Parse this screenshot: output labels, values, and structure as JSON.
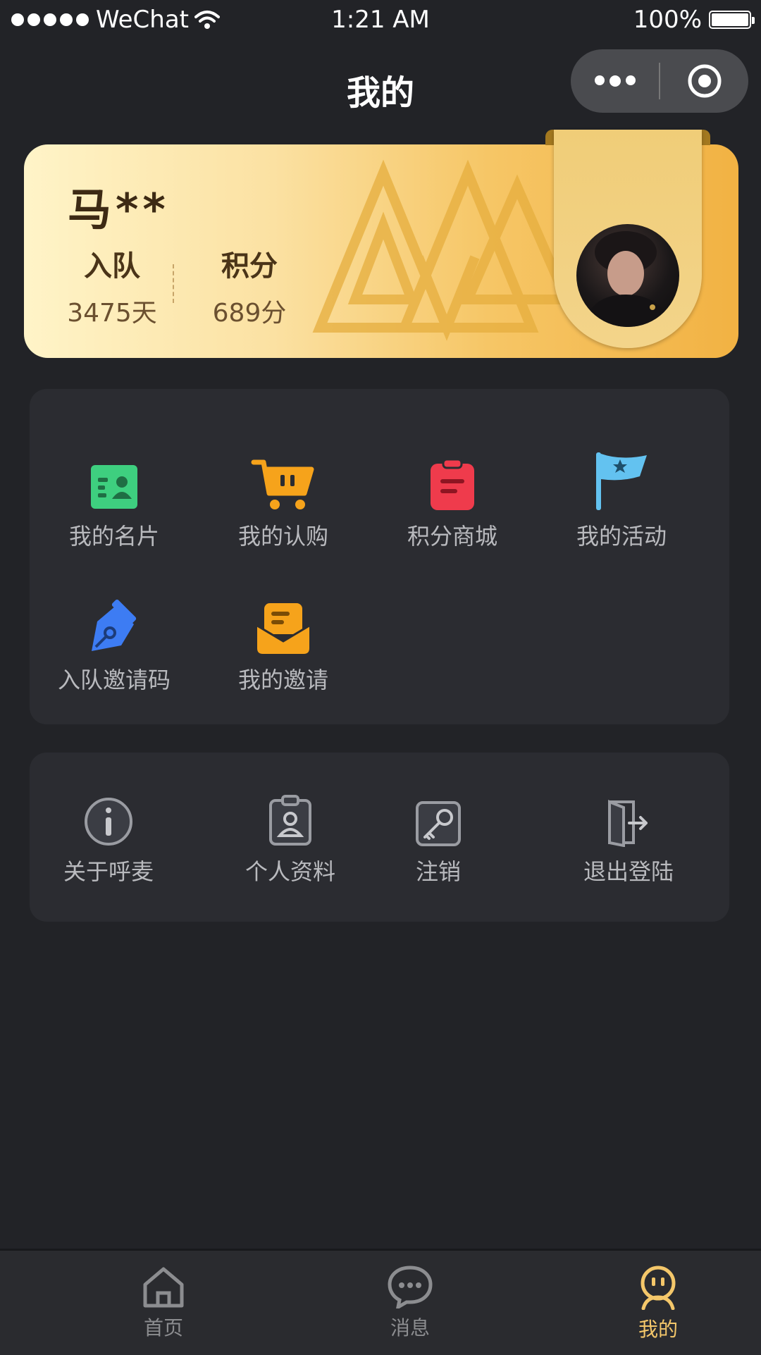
{
  "status_bar": {
    "carrier": "WeChat",
    "time": "1:21 AM",
    "battery": "100%"
  },
  "header": {
    "title": "我的"
  },
  "profile": {
    "name": "马**",
    "stats": [
      {
        "label": "入队",
        "value": "3475天"
      },
      {
        "label": "积分",
        "value": "689分"
      }
    ]
  },
  "menu": {
    "items": [
      {
        "label": "我的名片",
        "icon": "business-card-icon",
        "color": "#3ecf7f"
      },
      {
        "label": "我的认购",
        "icon": "shopping-cart-icon",
        "color": "#f6a31b"
      },
      {
        "label": "积分商城",
        "icon": "clipboard-icon",
        "color": "#ef3b4c"
      },
      {
        "label": "我的活动",
        "icon": "flag-icon",
        "color": "#63c2f0"
      },
      {
        "label": "入队邀请码",
        "icon": "pen-nib-icon",
        "color": "#3d7cf3"
      },
      {
        "label": "我的邀请",
        "icon": "envelope-icon",
        "color": "#f6a31b"
      }
    ]
  },
  "settings": {
    "items": [
      {
        "label": "关于呼麦",
        "icon": "info-icon"
      },
      {
        "label": "个人资料",
        "icon": "id-badge-icon"
      },
      {
        "label": "注销",
        "icon": "key-icon"
      },
      {
        "label": "退出登陆",
        "icon": "logout-door-icon"
      }
    ]
  },
  "tabbar": {
    "tabs": [
      {
        "label": "首页",
        "icon": "home-icon"
      },
      {
        "label": "消息",
        "icon": "chat-bubble-icon"
      },
      {
        "label": "我的",
        "icon": "user-face-icon",
        "active": true
      }
    ]
  }
}
